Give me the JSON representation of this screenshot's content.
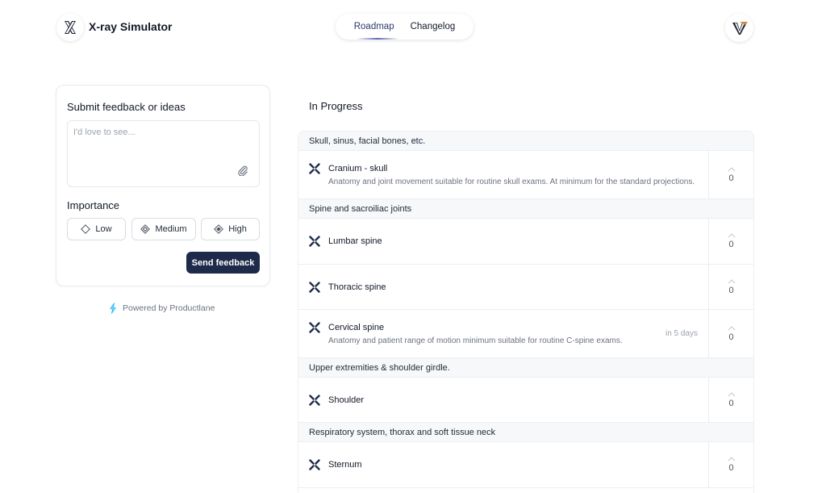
{
  "header": {
    "app_title": "X-ray Simulator",
    "tabs": [
      {
        "label": "Roadmap",
        "active": true
      },
      {
        "label": "Changelog",
        "active": false
      }
    ],
    "logo_icon": "x-logo-icon",
    "avatar_icon": "v-logo-icon"
  },
  "feedback": {
    "title": "Submit feedback or ideas",
    "placeholder": "I'd love to see...",
    "value": "",
    "importance_label": "Importance",
    "importance_options": [
      "Low",
      "Medium",
      "High"
    ],
    "send_label": "Send feedback"
  },
  "powered_by": "Powered by Productlane",
  "board": {
    "title": "In Progress",
    "groups": [
      {
        "name": "Skull, sinus, facial bones, etc.",
        "items": [
          {
            "title": "Cranium - skull",
            "description": "Anatomy and joint movement suitable for routine skull exams. At minimum for the standard projections.",
            "meta": "",
            "votes": "0"
          }
        ]
      },
      {
        "name": "Spine and sacroiliac joints",
        "items": [
          {
            "title": "Lumbar spine",
            "description": "",
            "meta": "",
            "votes": "0"
          },
          {
            "title": "Thoracic spine",
            "description": "",
            "meta": "",
            "votes": "0"
          },
          {
            "title": "Cervical spine",
            "description": "Anatomy and patient range of motion minimum suitable for routine C-spine exams.",
            "meta": "in 5 days",
            "votes": "0"
          }
        ]
      },
      {
        "name": "Upper extremities & shoulder girdle.",
        "items": [
          {
            "title": "Shoulder",
            "description": "",
            "meta": "",
            "votes": "0"
          }
        ]
      },
      {
        "name": "Respiratory system, thorax and soft tissue neck",
        "items": [
          {
            "title": "Sternum",
            "description": "",
            "meta": "",
            "votes": "0"
          }
        ]
      }
    ]
  },
  "colors": {
    "primary_button": "#1e2a4a",
    "active_tab": "#2d3a6b",
    "avatar_accent": "#d08a3c"
  }
}
